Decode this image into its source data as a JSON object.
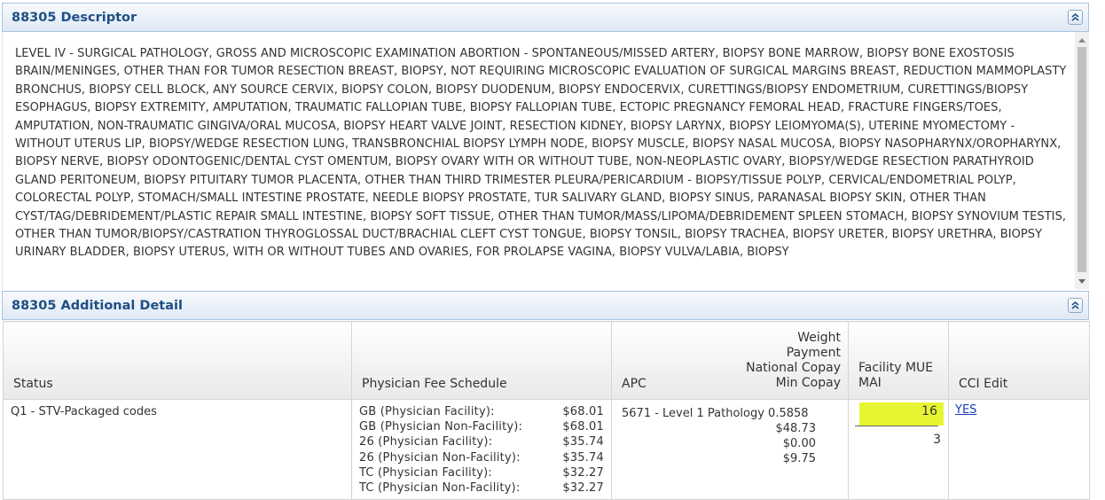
{
  "descriptor_panel": {
    "title": "88305 Descriptor",
    "text": "LEVEL IV - SURGICAL PATHOLOGY, GROSS AND MICROSCOPIC EXAMINATION ABORTION - SPONTANEOUS/MISSED ARTERY, BIOPSY BONE MARROW, BIOPSY BONE EXOSTOSIS BRAIN/MENINGES, OTHER THAN FOR TUMOR RESECTION BREAST, BIOPSY, NOT REQUIRING MICROSCOPIC EVALUATION OF SURGICAL MARGINS BREAST, REDUCTION MAMMOPLASTY BRONCHUS, BIOPSY CELL BLOCK, ANY SOURCE CERVIX, BIOPSY COLON, BIOPSY DUODENUM, BIOPSY ENDOCERVIX, CURETTINGS/BIOPSY ENDOMETRIUM, CURETTINGS/BIOPSY ESOPHAGUS, BIOPSY EXTREMITY, AMPUTATION, TRAUMATIC FALLOPIAN TUBE, BIOPSY FALLOPIAN TUBE, ECTOPIC PREGNANCY FEMORAL HEAD, FRACTURE FINGERS/TOES, AMPUTATION, NON-TRAUMATIC GINGIVA/ORAL MUCOSA, BIOPSY HEART VALVE JOINT, RESECTION KIDNEY, BIOPSY LARYNX, BIOPSY LEIOMYOMA(S), UTERINE MYOMECTOMY - WITHOUT UTERUS LIP, BIOPSY/WEDGE RESECTION LUNG, TRANSBRONCHIAL BIOPSY LYMPH NODE, BIOPSY MUSCLE, BIOPSY NASAL MUCOSA, BIOPSY NASOPHARYNX/OROPHARYNX, BIOPSY NERVE, BIOPSY ODONTOGENIC/DENTAL CYST OMENTUM, BIOPSY OVARY WITH OR WITHOUT TUBE, NON-NEOPLASTIC OVARY, BIOPSY/WEDGE RESECTION PARATHYROID GLAND PERITONEUM, BIOPSY PITUITARY TUMOR PLACENTA, OTHER THAN THIRD TRIMESTER PLEURA/PERICARDIUM - BIOPSY/TISSUE POLYP, CERVICAL/ENDOMETRIAL POLYP, COLORECTAL POLYP, STOMACH/SMALL INTESTINE PROSTATE, NEEDLE BIOPSY PROSTATE, TUR SALIVARY GLAND, BIOPSY SINUS, PARANASAL BIOPSY SKIN, OTHER THAN CYST/TAG/DEBRIDEMENT/PLASTIC REPAIR SMALL INTESTINE, BIOPSY SOFT TISSUE, OTHER THAN TUMOR/MASS/LIPOMA/DEBRIDEMENT SPLEEN STOMACH, BIOPSY SYNOVIUM TESTIS, OTHER THAN TUMOR/BIOPSY/CASTRATION THYROGLOSSAL DUCT/BRACHIAL CLEFT CYST TONGUE, BIOPSY TONSIL, BIOPSY TRACHEA, BIOPSY URETER, BIOPSY URETHRA, BIOPSY URINARY BLADDER, BIOPSY UTERUS, WITH OR WITHOUT TUBES AND OVARIES, FOR PROLAPSE VAGINA, BIOPSY VULVA/LABIA, BIOPSY"
  },
  "detail_panel": {
    "title": "88305 Additional Detail",
    "headers": {
      "status": "Status",
      "fee_schedule": "Physician Fee Schedule",
      "apc": "APC",
      "apc_right": [
        "Weight",
        "Payment",
        "National Copay",
        "Min Copay"
      ],
      "facility": [
        "Facility MUE",
        "MAI"
      ],
      "cci": "CCI Edit"
    },
    "row": {
      "status": "Q1 - STV-Packaged codes",
      "fees": [
        {
          "label": "GB (Physician Facility):",
          "amount": "$68.01"
        },
        {
          "label": "GB (Physician Non-Facility):",
          "amount": "$68.01"
        },
        {
          "label": "26 (Physician Facility):",
          "amount": "$35.74"
        },
        {
          "label": "26 (Physician Non-Facility):",
          "amount": "$35.74"
        },
        {
          "label": "TC (Physician Facility):",
          "amount": "$32.27"
        },
        {
          "label": "TC (Physician Non-Facility):",
          "amount": "$32.27"
        }
      ],
      "apc_line": "5671 - Level 1 Pathology 0.5858",
      "apc_values": [
        "$48.73",
        "$0.00",
        "$9.75"
      ],
      "facility_mue": "16",
      "mai": "3",
      "cci_edit": "YES"
    },
    "highlight_color": "#e6f532"
  }
}
